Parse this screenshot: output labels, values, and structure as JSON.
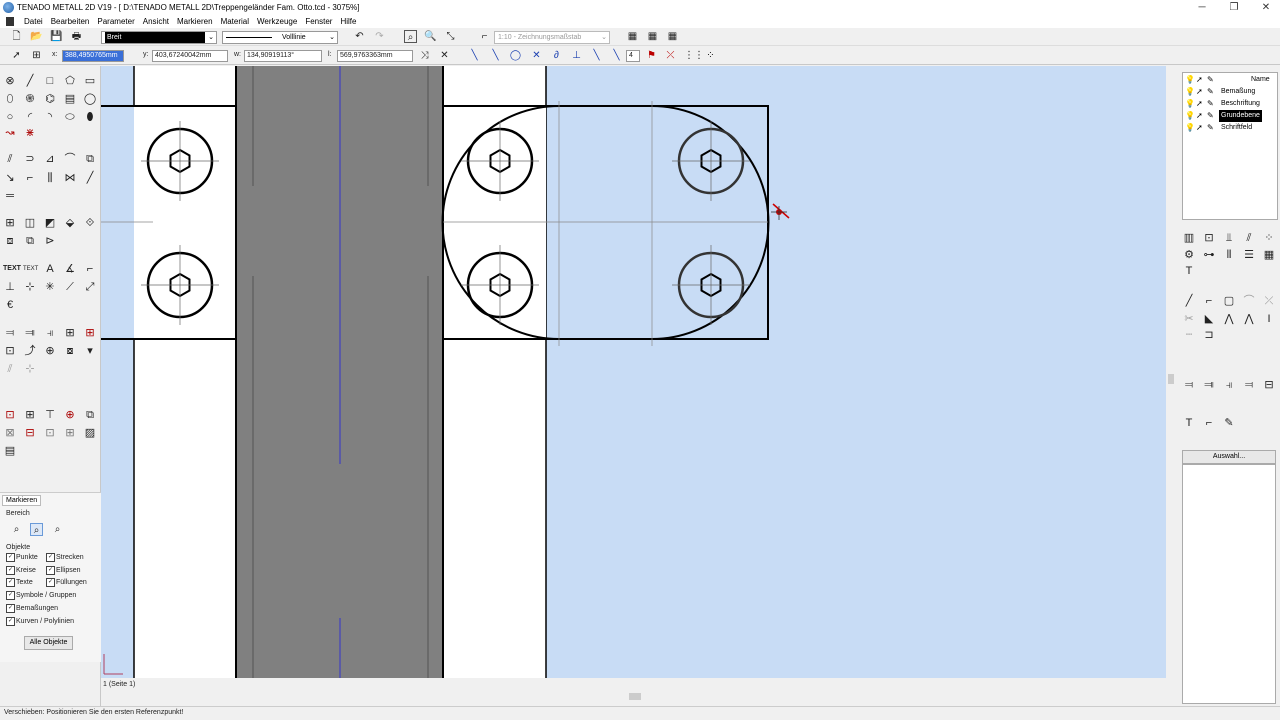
{
  "window": {
    "title": "TENADO METALL 2D V19 - [ D:\\TENADO METALL 2D\\Treppengeländer Fam. Otto.tcd - 3075%]",
    "minimize": "─",
    "maximize": "❐",
    "close": "✕"
  },
  "menu": [
    "Datei",
    "Bearbeiten",
    "Parameter",
    "Ansicht",
    "Markieren",
    "Material",
    "Werkzeuge",
    "Fenster",
    "Hilfe"
  ],
  "toolbar": {
    "pen_combo": "Breit",
    "line_combo": "Volllinie",
    "scale_combo": "1:10 - Zeichnungsmaßstab"
  },
  "coords": {
    "x_label": "x:",
    "x_value": "388,4950765mm",
    "y_label": "y:",
    "y_value": "403,67240042mm",
    "w_label": "w:",
    "w_value": "134,90919113°",
    "l_label": "l:",
    "l_value": "569,9763363mm",
    "snap_value": "4"
  },
  "mark_panel": {
    "tab": "Markieren",
    "bereich": "Bereich",
    "objekte": "Objekte",
    "checkboxes": [
      "Punkte",
      "Strecken",
      "Kreise",
      "Ellipsen",
      "Texte",
      "Füllungen",
      "Symbole / Gruppen",
      "Bemaßungen",
      "Kurven / Polylinien"
    ],
    "alle_button": "Alle Objekte"
  },
  "layers": {
    "header": "Name",
    "items": [
      "Bemaßung",
      "Beschriftung",
      "Grundebene",
      "Schriftfeld"
    ],
    "selected": "Grundebene"
  },
  "auswahl_button": "Auswahl...",
  "page_tab": "1 (Seite 1)",
  "status": "Verschieben: Positionieren Sie den ersten Referenzpunkt!",
  "icons": {
    "left": [
      "point-icon",
      "line-icon",
      "rectangle-icon",
      "polygon-icon",
      "rounded-rect-icon"
    ],
    "hex": "⬡"
  },
  "colors": {
    "selection_fill": "#c8dcf5",
    "bar_fill": "#808080",
    "axis_blue": "#3333cc",
    "cursor_red": "#cc0000"
  }
}
